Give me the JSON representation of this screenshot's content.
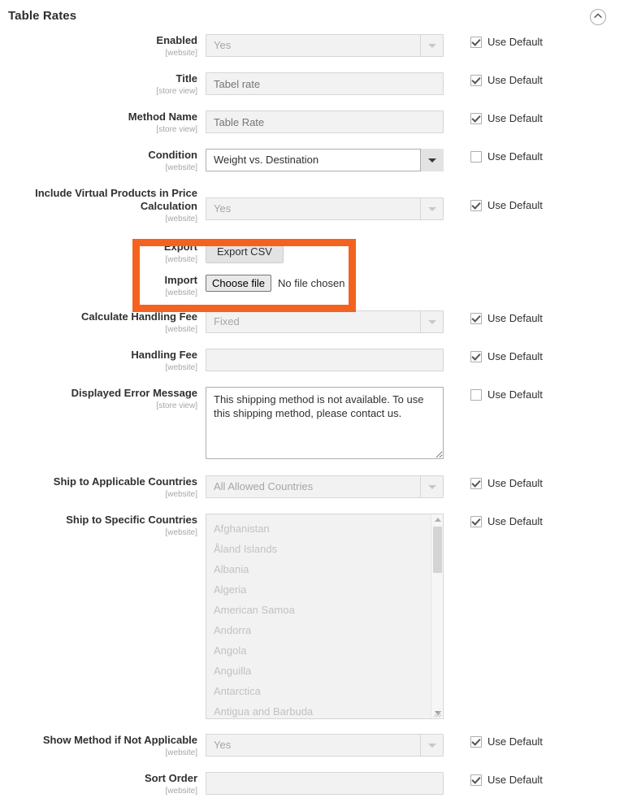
{
  "section": {
    "title": "Table Rates",
    "collapse_icon": "chevron-up-circle-icon"
  },
  "fields": {
    "enabled": {
      "label": "Enabled",
      "scope": "[website]",
      "value": "Yes",
      "use_default_label": "Use Default",
      "use_default_checked": true,
      "disabled": true
    },
    "title": {
      "label": "Title",
      "scope": "[store view]",
      "value": "Tabel rate",
      "use_default_label": "Use Default",
      "use_default_checked": true,
      "disabled": true
    },
    "method_name": {
      "label": "Method Name",
      "scope": "[store view]",
      "value": "Table Rate",
      "use_default_label": "Use Default",
      "use_default_checked": true,
      "disabled": true
    },
    "condition": {
      "label": "Condition",
      "scope": "[website]",
      "value": "Weight vs. Destination",
      "use_default_label": "Use Default",
      "use_default_checked": false,
      "disabled": false
    },
    "include_virtual": {
      "label": "Include Virtual Products in Price Calculation",
      "scope": "[website]",
      "value": "Yes",
      "use_default_label": "Use Default",
      "use_default_checked": true,
      "disabled": true
    },
    "export": {
      "label": "Export",
      "scope": "[website]",
      "button_label": "Export CSV"
    },
    "import": {
      "label": "Import",
      "scope": "[website]",
      "choose_file_label": "Choose file",
      "file_status": "No file chosen"
    },
    "calculate_handling_fee": {
      "label": "Calculate Handling Fee",
      "scope": "[website]",
      "value": "Fixed",
      "use_default_label": "Use Default",
      "use_default_checked": true,
      "disabled": true
    },
    "handling_fee": {
      "label": "Handling Fee",
      "scope": "[website]",
      "value": "",
      "use_default_label": "Use Default",
      "use_default_checked": true,
      "disabled": true
    },
    "displayed_error_message": {
      "label": "Displayed Error Message",
      "scope": "[store view]",
      "value": "This shipping method is not available. To use this shipping method, please contact us.",
      "use_default_label": "Use Default",
      "use_default_checked": false,
      "disabled": false
    },
    "ship_to_applicable_countries": {
      "label": "Ship to Applicable Countries",
      "scope": "[website]",
      "value": "All Allowed Countries",
      "use_default_label": "Use Default",
      "use_default_checked": true,
      "disabled": true
    },
    "ship_to_specific_countries": {
      "label": "Ship to Specific Countries",
      "scope": "[website]",
      "use_default_label": "Use Default",
      "use_default_checked": true,
      "disabled": true,
      "options": [
        "Afghanistan",
        "Åland Islands",
        "Albania",
        "Algeria",
        "American Samoa",
        "Andorra",
        "Angola",
        "Anguilla",
        "Antarctica",
        "Antigua and Barbuda"
      ]
    },
    "show_method_if_not_applicable": {
      "label": "Show Method if Not Applicable",
      "scope": "[website]",
      "value": "Yes",
      "use_default_label": "Use Default",
      "use_default_checked": true,
      "disabled": true
    },
    "sort_order": {
      "label": "Sort Order",
      "scope": "[website]",
      "value": "",
      "use_default_label": "Use Default",
      "use_default_checked": true,
      "disabled": true
    }
  },
  "highlight": {
    "color": "#F4621F",
    "covers": "export-and-import-rows"
  }
}
